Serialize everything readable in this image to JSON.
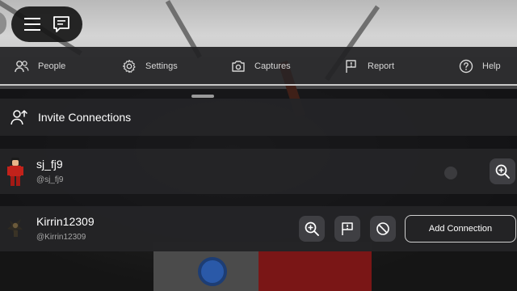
{
  "tabs": [
    {
      "label": "People",
      "icon": "people-icon"
    },
    {
      "label": "Settings",
      "icon": "gear-icon"
    },
    {
      "label": "Captures",
      "icon": "camera-icon"
    },
    {
      "label": "Report",
      "icon": "flag-icon"
    },
    {
      "label": "Help",
      "icon": "help-icon"
    }
  ],
  "invite": {
    "label": "Invite Connections",
    "icon": "add-person-icon"
  },
  "people": [
    {
      "name": "sj_fj9",
      "handle": "@sj_fj9"
    },
    {
      "name": "Kirrin12309",
      "handle": "@Kirrin12309",
      "action_label": "Add Connection"
    }
  ],
  "top_menu": {
    "menu_icon": "hamburger-icon",
    "chat_icon": "chat-icon"
  },
  "colors": {
    "panel": "#242426",
    "button": "#3f3f43",
    "text": "#ffffff",
    "muted": "#a6a6a6"
  }
}
